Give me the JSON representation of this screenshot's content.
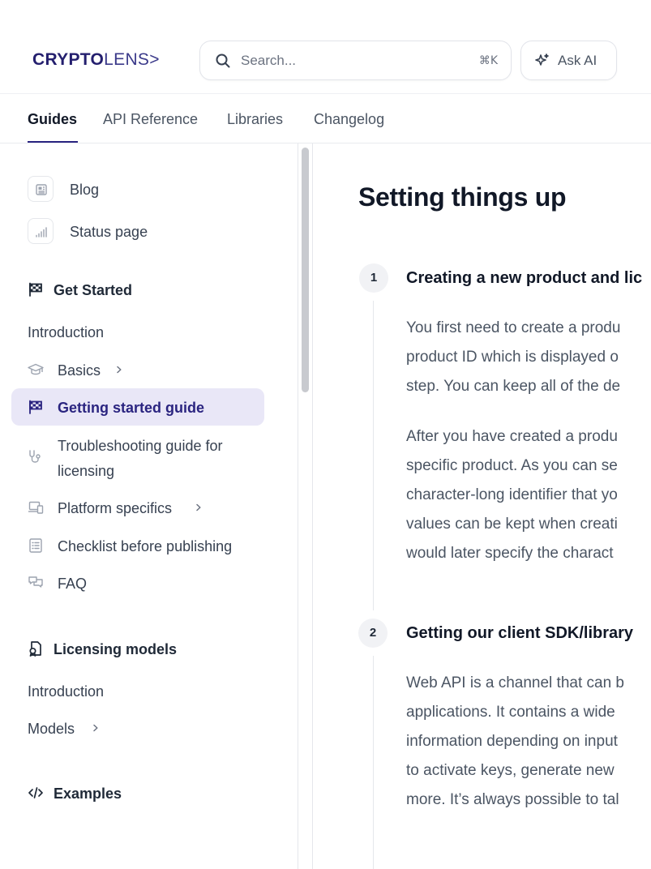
{
  "header": {
    "logo": {
      "bold": "CRYPTO",
      "light": "LENS>"
    },
    "search": {
      "placeholder": "Search...",
      "shortcut": "⌘K",
      "icon": "search-icon"
    },
    "ask_ai": {
      "label": "Ask AI",
      "icon": "sparkles-icon"
    }
  },
  "tabs": [
    {
      "label": "Guides",
      "active": true
    },
    {
      "label": "API Reference"
    },
    {
      "label": "Libraries"
    },
    {
      "label": "Changelog"
    }
  ],
  "sidebar": {
    "links": [
      {
        "label": "Blog",
        "icon": "newspaper-icon"
      },
      {
        "label": "Status page",
        "icon": "signal-bars-icon"
      }
    ],
    "sections": [
      {
        "title": "Get Started",
        "icon": "flag-icon",
        "items": [
          {
            "label": "Introduction"
          },
          {
            "label": "Basics",
            "icon": "graduation-cap-icon",
            "expandable": true
          },
          {
            "label": "Getting started guide",
            "icon": "flag-icon",
            "active": true
          },
          {
            "label_line1": "Troubleshooting guide for",
            "label_line2": "licensing",
            "icon": "stethoscope-icon"
          },
          {
            "label": "Platform specifics",
            "icon": "devices-icon",
            "expandable": true
          },
          {
            "label": "Checklist before publishing",
            "icon": "checklist-icon"
          },
          {
            "label": "FAQ",
            "icon": "chat-bubbles-icon"
          }
        ]
      },
      {
        "title": "Licensing models",
        "icon": "license-document-icon",
        "items": [
          {
            "label": "Introduction"
          },
          {
            "label": "Models",
            "expandable": true
          }
        ]
      },
      {
        "title": "Examples",
        "icon": "code-icon",
        "items": []
      }
    ]
  },
  "main": {
    "title": "Setting things up",
    "steps": [
      {
        "number": "1",
        "title": "Creating a new product and lic",
        "paragraphs": [
          [
            "You first need to create a produ",
            "product ID which is displayed o",
            "step. You can keep all of the de"
          ],
          [
            "After you have created a produ",
            "specific product. As you can se",
            "character-long identifier that yo",
            "values can be kept when creati",
            "would later specify the charact"
          ]
        ]
      },
      {
        "number": "2",
        "title": "Getting our client SDK/library",
        "paragraphs": [
          [
            "Web API is a channel that can b",
            "applications. It contains a wide",
            "information depending on input",
            "to activate keys, generate new",
            "more. It’s always possible to tal"
          ]
        ]
      }
    ]
  },
  "colors": {
    "accent": "#2a2480",
    "active_bg": "#e9e7f7",
    "border": "#e5e7eb"
  }
}
